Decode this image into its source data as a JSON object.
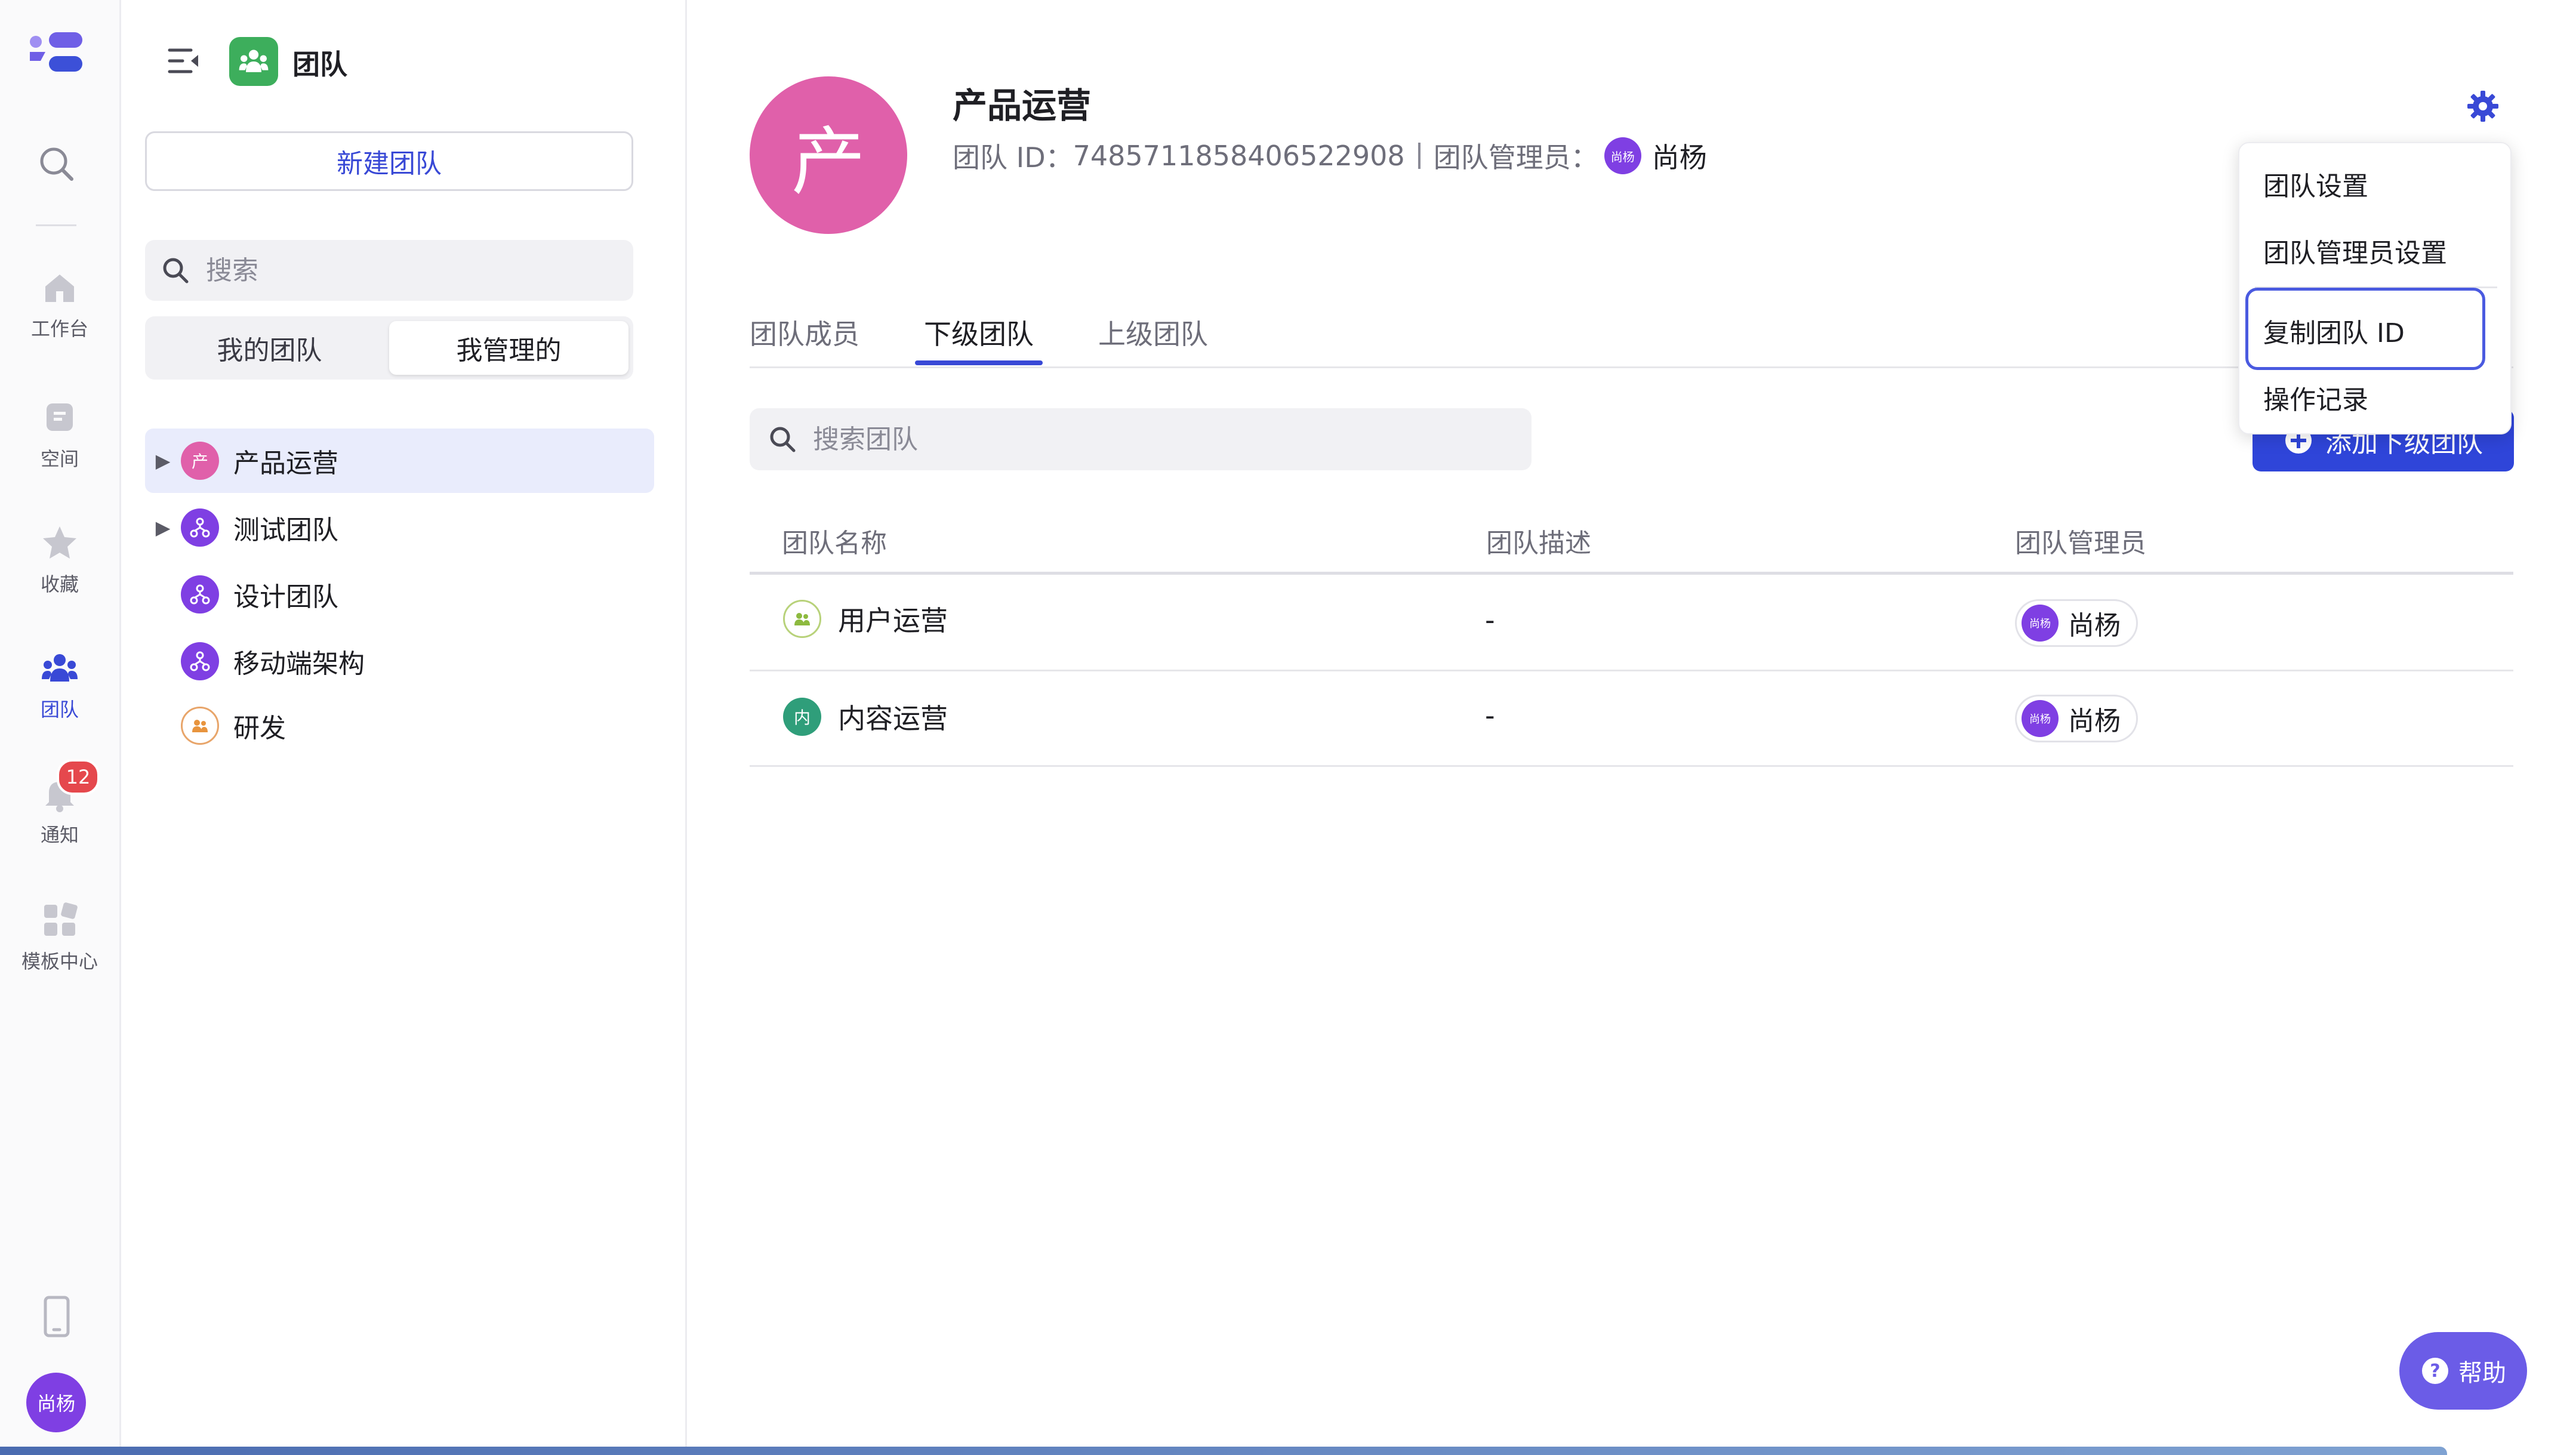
{
  "rail": {
    "items": [
      {
        "label": "工作台"
      },
      {
        "label": "空间"
      },
      {
        "label": "收藏"
      },
      {
        "label": "团队"
      },
      {
        "label": "通知"
      },
      {
        "label": "模板中心"
      }
    ],
    "notification_badge": "12",
    "user_avatar": "尚杨"
  },
  "sidebar": {
    "title": "团队",
    "new_team": "新建团队",
    "search_placeholder": "搜索",
    "segments": [
      "我的团队",
      "我管理的"
    ],
    "tree": [
      {
        "label": "产品运营",
        "avatar": "产"
      },
      {
        "label": "测试团队"
      },
      {
        "label": "设计团队"
      },
      {
        "label": "移动端架构"
      },
      {
        "label": "研发"
      }
    ]
  },
  "team": {
    "avatar": "产",
    "name": "产品运营",
    "id_label": "团队 ID：",
    "id_value": "7485711858406522908",
    "admin_label": "团队管理员：",
    "admin_avatar": "尚杨",
    "admin_name": "尚杨"
  },
  "tabs": [
    "团队成员",
    "下级团队",
    "上级团队"
  ],
  "subteam": {
    "search_placeholder": "搜索团队",
    "add_button": "添加下级团队",
    "columns": [
      "团队名称",
      "团队描述",
      "团队管理员"
    ],
    "rows": [
      {
        "name": "用户运营",
        "avatar": "",
        "desc": "-",
        "admin_avatar": "尚杨",
        "admin": "尚杨"
      },
      {
        "name": "内容运营",
        "avatar": "内",
        "desc": "-",
        "admin_avatar": "尚杨",
        "admin": "尚杨"
      }
    ]
  },
  "dropdown": {
    "items": [
      "团队设置",
      "团队管理员设置",
      "复制团队 ID",
      "操作记录"
    ]
  },
  "help": "帮助",
  "colors": {
    "accent": "#3949d6",
    "team_avatar": "#e060aa",
    "user_avatar": "#7f3fe3",
    "help": "#6b5ce7"
  }
}
